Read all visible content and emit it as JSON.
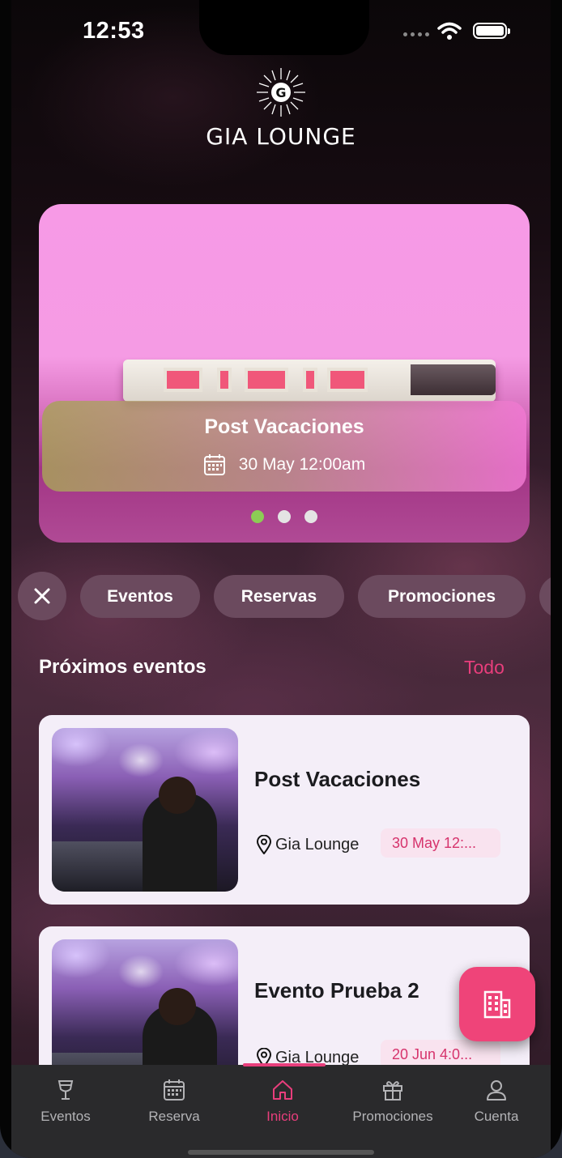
{
  "status_bar": {
    "time": "12:53"
  },
  "brand": {
    "name": "GIA LOUNGE",
    "icon": "sunburst-g-logo"
  },
  "carousel": {
    "slides": [
      {
        "title": "Post Vacaciones",
        "date": "30 May 12:00am"
      }
    ],
    "slide_count": 3,
    "active_index": 0,
    "colors": {
      "active_dot": "#8ccc55",
      "inactive_dot": "#e4e4e4"
    }
  },
  "filters": {
    "clear_icon": "close-icon",
    "chips": [
      "Eventos",
      "Reservas",
      "Promociones"
    ]
  },
  "upcoming": {
    "title": "Próximos eventos",
    "see_all": "Todo",
    "events": [
      {
        "title": "Post Vacaciones",
        "venue": "Gia  Lounge",
        "date": "30 May 12:..."
      },
      {
        "title": "Evento Prueba 2",
        "venue": "Gia  Lounge",
        "date": "20 Jun 4:0..."
      }
    ]
  },
  "fab": {
    "icon": "building-icon"
  },
  "bottom_nav": {
    "items": [
      {
        "label": "Eventos",
        "icon": "cocktail-glass-icon"
      },
      {
        "label": "Reserva",
        "icon": "calendar-icon"
      },
      {
        "label": "Inicio",
        "icon": "home-icon"
      },
      {
        "label": "Promociones",
        "icon": "gift-icon"
      },
      {
        "label": "Cuenta",
        "icon": "user-icon"
      }
    ],
    "active_index": 2
  },
  "colors": {
    "accent": "#e83e7c",
    "fab": "#ef4479",
    "chip_bg": "#6b4a5e",
    "card_bg": "#f4eef8",
    "nav_bg": "#2a2a2c"
  }
}
